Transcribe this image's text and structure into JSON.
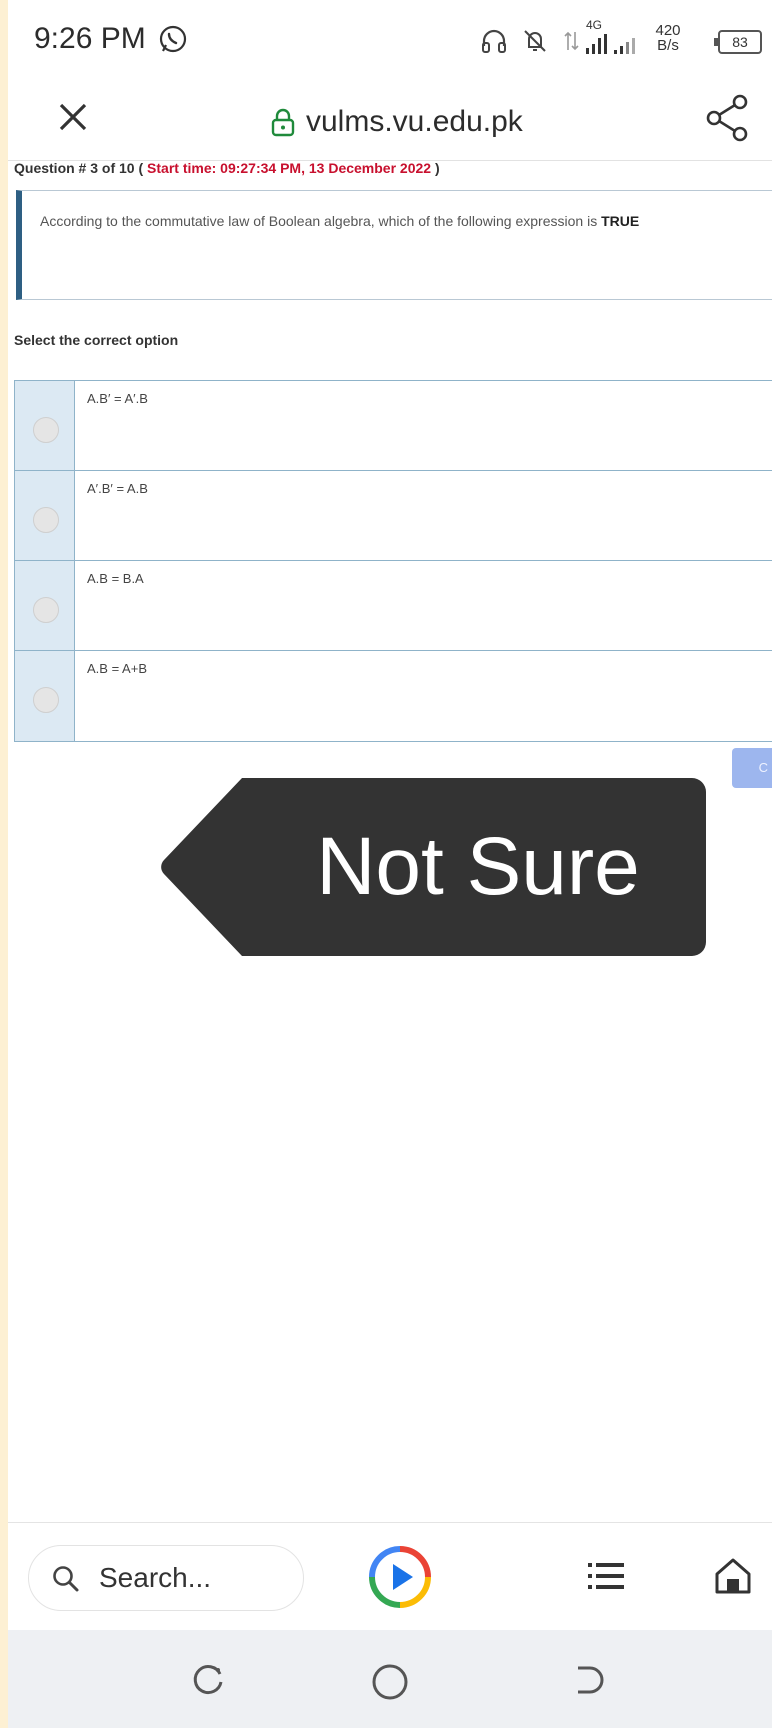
{
  "status_bar": {
    "time": "9:26 PM",
    "net_type": "4G",
    "speed_value": "420",
    "speed_unit": "B/s",
    "battery": "83"
  },
  "toolbar": {
    "url": "vulms.vu.edu.pk"
  },
  "question": {
    "header_prefix": "Question # 3 of 10 (",
    "start_time": "Start time: 09:27:34 PM, 13 December 2022",
    "header_suffix": ")",
    "text": "According to the commutative law of Boolean algebra, which of the following expression is ",
    "text_emphasis": "TRUE"
  },
  "select_label": "Select the correct option",
  "options": [
    {
      "label": "A.B′ = A′.B"
    },
    {
      "label": "A′.B′ = A.B"
    },
    {
      "label": "A.B = B.A"
    },
    {
      "label": "A.B = A+B"
    }
  ],
  "next_button": "C",
  "callout": "Not Sure",
  "bottom_bar": {
    "search_placeholder": "Search..."
  },
  "colors": {
    "start_time": "#c8102e",
    "question_border": "#2e5f83",
    "radio_column": "#dce9f3",
    "callout_bg": "#333333"
  }
}
